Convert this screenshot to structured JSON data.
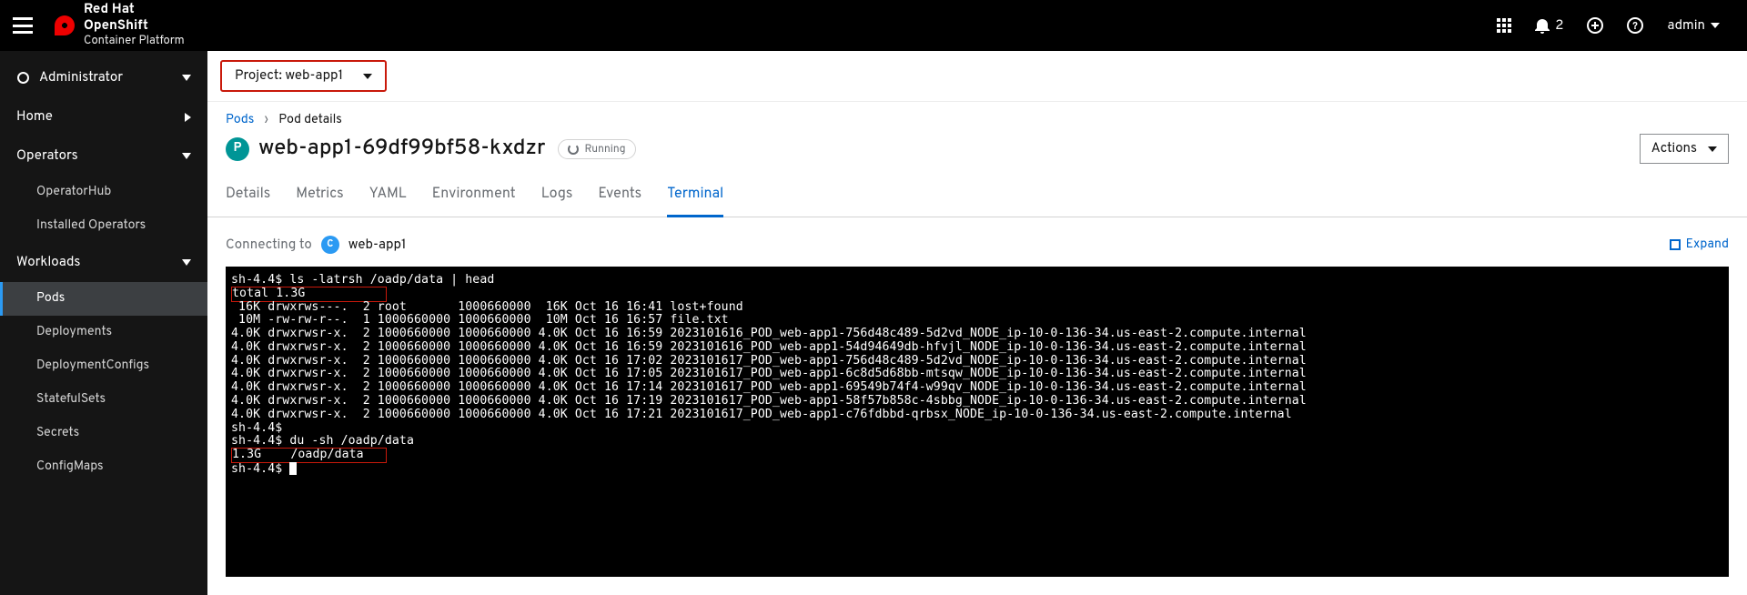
{
  "brand": {
    "line1": "Red Hat",
    "line2": "OpenShift",
    "line3": "Container Platform"
  },
  "topbar": {
    "notif_count": "2",
    "user": "admin"
  },
  "sidebar": {
    "administrator": "Administrator",
    "home": "Home",
    "operators": "Operators",
    "operators_items": {
      "hub": "OperatorHub",
      "installed": "Installed Operators"
    },
    "workloads": "Workloads",
    "workloads_items": {
      "pods": "Pods",
      "deployments": "Deployments",
      "deploymentconfigs": "DeploymentConfigs",
      "statefulsets": "StatefulSets",
      "secrets": "Secrets",
      "configmaps": "ConfigMaps"
    }
  },
  "project": {
    "label": "Project:",
    "value": "web-app1"
  },
  "crumb": {
    "root": "Pods",
    "current": "Pod details"
  },
  "pod": {
    "badge": "P",
    "name": "web-app1-69df99bf58-kxdzr",
    "status": "Running",
    "actions": "Actions"
  },
  "tabs": {
    "details": "Details",
    "metrics": "Metrics",
    "yaml": "YAML",
    "environment": "Environment",
    "logs": "Logs",
    "events": "Events",
    "terminal": "Terminal"
  },
  "term": {
    "connecting": "Connecting to",
    "container_badge": "C",
    "container": "web-app1",
    "expand": "Expand"
  },
  "terminal_lines": {
    "l0": "sh-4.4$ ls -latrsh /oadp/data | head",
    "l1a": "total 1.3G",
    "l2": " 16K drwxrws---.  2 root       1000660000  16K Oct 16 16:41 lost+found",
    "l3": " 10M -rw-rw-r--.  1 1000660000 1000660000  10M Oct 16 16:57 file.txt",
    "l4": "4.0K drwxrwsr-x.  2 1000660000 1000660000 4.0K Oct 16 16:59 2023101616_POD_web-app1-756d48c489-5d2vd_NODE_ip-10-0-136-34.us-east-2.compute.internal",
    "l5": "4.0K drwxrwsr-x.  2 1000660000 1000660000 4.0K Oct 16 16:59 2023101616_POD_web-app1-54d94649db-hfvjl_NODE_ip-10-0-136-34.us-east-2.compute.internal",
    "l6": "4.0K drwxrwsr-x.  2 1000660000 1000660000 4.0K Oct 16 17:02 2023101617_POD_web-app1-756d48c489-5d2vd_NODE_ip-10-0-136-34.us-east-2.compute.internal",
    "l7": "4.0K drwxrwsr-x.  2 1000660000 1000660000 4.0K Oct 16 17:05 2023101617_POD_web-app1-6c8d5d68bb-mtsqw_NODE_ip-10-0-136-34.us-east-2.compute.internal",
    "l8": "4.0K drwxrwsr-x.  2 1000660000 1000660000 4.0K Oct 16 17:14 2023101617_POD_web-app1-69549b74f4-w99qv_NODE_ip-10-0-136-34.us-east-2.compute.internal",
    "l9": "4.0K drwxrwsr-x.  2 1000660000 1000660000 4.0K Oct 16 17:19 2023101617_POD_web-app1-58f57b858c-4sbbg_NODE_ip-10-0-136-34.us-east-2.compute.internal",
    "l10": "4.0K drwxrwsr-x.  2 1000660000 1000660000 4.0K Oct 16 17:21 2023101617_POD_web-app1-c76fdbbd-qrbsx_NODE_ip-10-0-136-34.us-east-2.compute.internal",
    "l11": "sh-4.4$",
    "l12": "sh-4.4$ du -sh /oadp/data",
    "l13a": "1.3G\t/oadp/data",
    "l14": "sh-4.4$ "
  }
}
